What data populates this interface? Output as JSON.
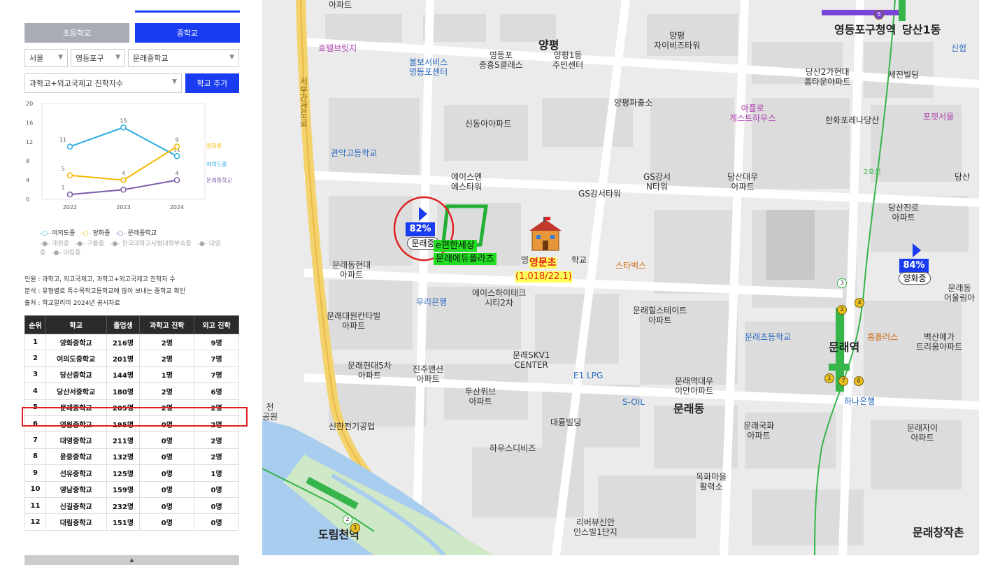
{
  "tabs": {
    "elementary": "초등학교",
    "middle": "중학교"
  },
  "filters": {
    "city": "서울",
    "district": "영등포구",
    "school": "문래중학교",
    "metric": "과학고+외고국제고 진학자수",
    "add_button": "학교 추가"
  },
  "chart_data": {
    "type": "line",
    "x": [
      "2022",
      "2023",
      "2024"
    ],
    "ylim": [
      0,
      20
    ],
    "yticks": [
      "20",
      "16",
      "12",
      "8",
      "4",
      "0"
    ],
    "series": [
      {
        "name": "여의도중",
        "color": "#29abe2",
        "values": [
          11,
          15,
          9
        ],
        "labels": [
          "11",
          "15",
          "11"
        ]
      },
      {
        "name": "양화중",
        "color": "#f5b800",
        "values": [
          5,
          4,
          11
        ],
        "labels": [
          "5",
          "4",
          "9"
        ]
      },
      {
        "name": "문래중학교",
        "color": "#7a5ca8",
        "values": [
          1,
          2,
          4
        ],
        "labels": [
          "1",
          "",
          "4"
        ]
      }
    ]
  },
  "legend_extra": [
    "개원중",
    "구룡중",
    "한국대학교사범대학부속중",
    "대영중",
    "대림중"
  ],
  "notes": [
    "인원 : 과학고, 외고국제고, 과학고+외고국제고 진학자 수",
    "분석 : 유형별로 특수목적고등학교에 많이 보내는 중학교 확인",
    "출처 : 학교알리미 2024년 공시자료"
  ],
  "table": {
    "headers": [
      "순위",
      "학교",
      "졸업생",
      "과학고 진학",
      "외고 진학"
    ],
    "rows": [
      [
        "1",
        "양화중학교",
        "216명",
        "2명",
        "9명"
      ],
      [
        "2",
        "여의도중학교",
        "201명",
        "2명",
        "7명"
      ],
      [
        "3",
        "당산중학교",
        "144명",
        "1명",
        "7명"
      ],
      [
        "4",
        "당산서중학교",
        "180명",
        "2명",
        "6명"
      ],
      [
        "5",
        "문래중학교",
        "205명",
        "2명",
        "2명"
      ],
      [
        "6",
        "영원중학교",
        "195명",
        "0명",
        "2명"
      ],
      [
        "7",
        "대영중학교",
        "211명",
        "0명",
        "2명"
      ],
      [
        "8",
        "윤중중학교",
        "132명",
        "0명",
        "2명"
      ],
      [
        "9",
        "선유중학교",
        "125명",
        "0명",
        "1명"
      ],
      [
        "10",
        "영남중학교",
        "159명",
        "0명",
        "0명"
      ],
      [
        "11",
        "신길중학교",
        "232명",
        "0명",
        "0명"
      ],
      [
        "12",
        "대림중학교",
        "151명",
        "0명",
        "0명"
      ]
    ]
  },
  "scroll_arrow": "▲",
  "map": {
    "markers": {
      "munrae_pct": "82%",
      "munrae_name": "문래중",
      "yanghwa_pct": "84%",
      "yanghwa_name": "양화중",
      "ymc_name": "영문초",
      "ymc_stats": "(1,018/22.1)",
      "academy1": "e편한세상",
      "academy2": "문래에듀플라츠"
    },
    "labels": [
      {
        "t": "아파트"
      },
      {
        "t": "호텔브릿지"
      },
      {
        "t": "볼보서비스\n영등포센터"
      },
      {
        "t": "영등포\n중흥S클래스"
      },
      {
        "t": "양평1동\n주민센터"
      },
      {
        "t": "양평\n자이비즈타워"
      },
      {
        "t": "영등포구청역"
      },
      {
        "t": "당산1동"
      },
      {
        "t": "신협"
      },
      {
        "t": "당산2가현대\n홈타운아파트"
      },
      {
        "t": "세진빌딩"
      },
      {
        "t": "양평파출소"
      },
      {
        "t": "아플로\n게스트하우스"
      },
      {
        "t": "한화포레나당산"
      },
      {
        "t": "포켓서울"
      },
      {
        "t": "신동아아파트"
      },
      {
        "t": "관악고등학교"
      },
      {
        "t": "에이스엔\n에스타워"
      },
      {
        "t": "GS강서타워"
      },
      {
        "t": "GS강서\nN타워"
      },
      {
        "t": "당산대우\n아파트"
      },
      {
        "t": "당산"
      },
      {
        "t": "당산진로\n아파트"
      },
      {
        "t": "문래동현대\n아파트"
      },
      {
        "t": "스타벅스"
      },
      {
        "t": "우리은행"
      },
      {
        "t": "에이스하이테크\n시티2차"
      },
      {
        "t": "문래대원칸타빌\n아파트"
      },
      {
        "t": "문래힐스테이트\n아파트"
      },
      {
        "t": "문래초등학교"
      },
      {
        "t": "문래역"
      },
      {
        "t": "홈플러스"
      },
      {
        "t": "벽산메가\n트리움아파트"
      },
      {
        "t": "문래동\n어울림아"
      },
      {
        "t": "문래현대5차\n아파트"
      },
      {
        "t": "진주맨션\n아파트"
      },
      {
        "t": "문래SKV1\nCENTER"
      },
      {
        "t": "E1 LPG"
      },
      {
        "t": "문래역대우\n이안아파트"
      },
      {
        "t": "두산위브\n아파트"
      },
      {
        "t": "S-OIL"
      },
      {
        "t": "문래동"
      },
      {
        "t": "하나은행"
      },
      {
        "t": "신한전기공업"
      },
      {
        "t": "대륭빌딩"
      },
      {
        "t": "문래국화\n아파트"
      },
      {
        "t": "문래자이\n아파트"
      },
      {
        "t": "하우스디비즈"
      },
      {
        "t": "목화마을\n활력소"
      },
      {
        "t": "리버뷰신안\n인스빌1단지"
      },
      {
        "t": "도림천역"
      },
      {
        "t": "문래창작촌"
      },
      {
        "t": "양평"
      },
      {
        "t": "서부간선도로"
      },
      {
        "t": "2호선"
      },
      {
        "t": "천\n공원"
      },
      {
        "t": "영"
      },
      {
        "t": "학교"
      }
    ],
    "stations": [
      "5",
      "3",
      "2",
      "4",
      "1",
      "7",
      "6",
      "2",
      "1"
    ]
  }
}
